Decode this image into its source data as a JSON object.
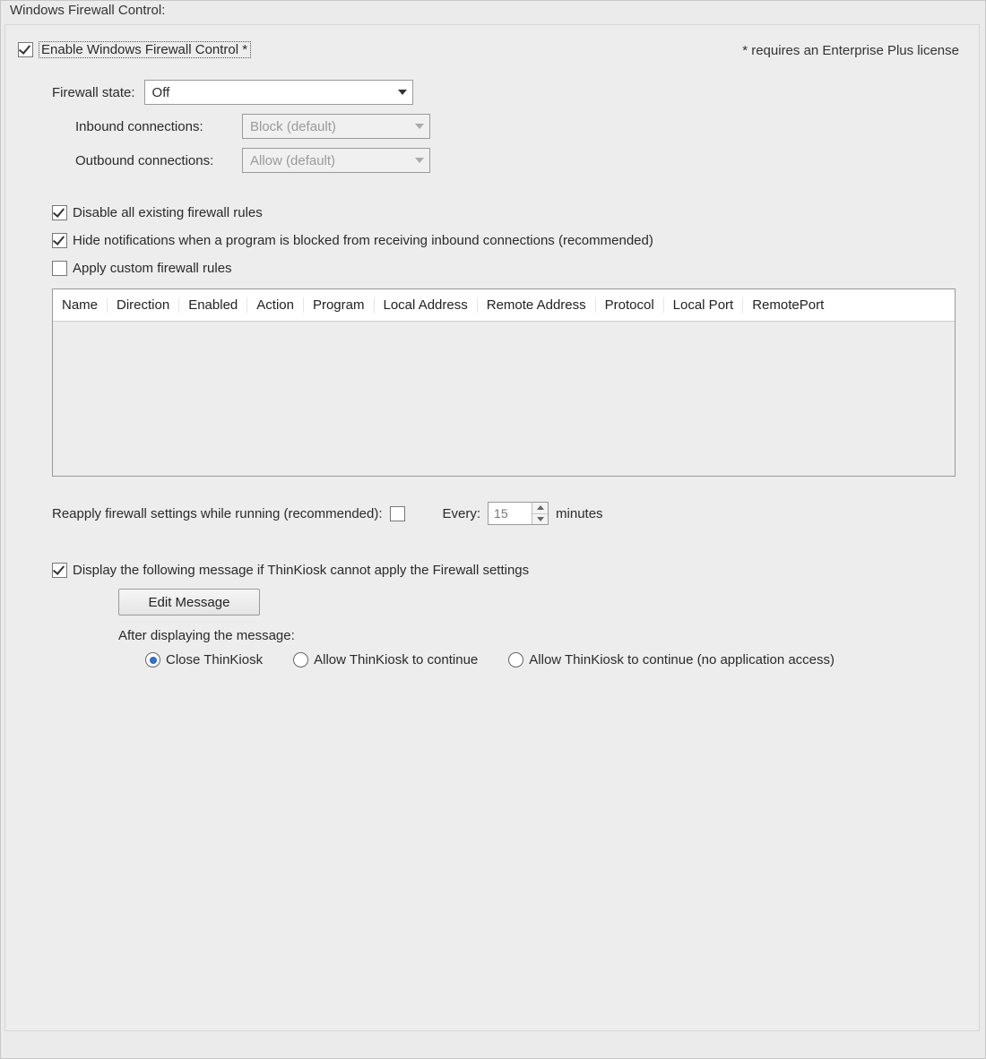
{
  "panel": {
    "title": "Windows Firewall Control:"
  },
  "enable": {
    "label": "Enable Windows Firewall Control *"
  },
  "license_note": "* requires an Enterprise Plus license",
  "firewall_state": {
    "label": "Firewall state:",
    "value": "Off"
  },
  "inbound": {
    "label": "Inbound connections:",
    "value": "Block (default)"
  },
  "outbound": {
    "label": "Outbound connections:",
    "value": "Allow (default)"
  },
  "disable_rules": {
    "label": "Disable all existing firewall rules"
  },
  "hide_notifications": {
    "label": "Hide notifications when a program is blocked from receiving inbound connections (recommended)"
  },
  "apply_custom": {
    "label": "Apply custom firewall rules"
  },
  "table": {
    "headers": [
      "Name",
      "Direction",
      "Enabled",
      "Action",
      "Program",
      "Local Address",
      "Remote Address",
      "Protocol",
      "Local Port",
      "RemotePort"
    ]
  },
  "reapply": {
    "label": "Reapply firewall settings while running (recommended):",
    "every_label": "Every:",
    "minutes_value": "15",
    "minutes_unit": "minutes"
  },
  "display_msg": {
    "label": "Display the following message if ThinKiosk cannot apply the Firewall settings"
  },
  "edit_button": "Edit Message",
  "after_label": "After displaying the message:",
  "radios": {
    "close": "Close ThinKiosk",
    "continue": "Allow ThinKiosk to continue",
    "continue_noapp": "Allow ThinKiosk to continue (no application access)"
  }
}
